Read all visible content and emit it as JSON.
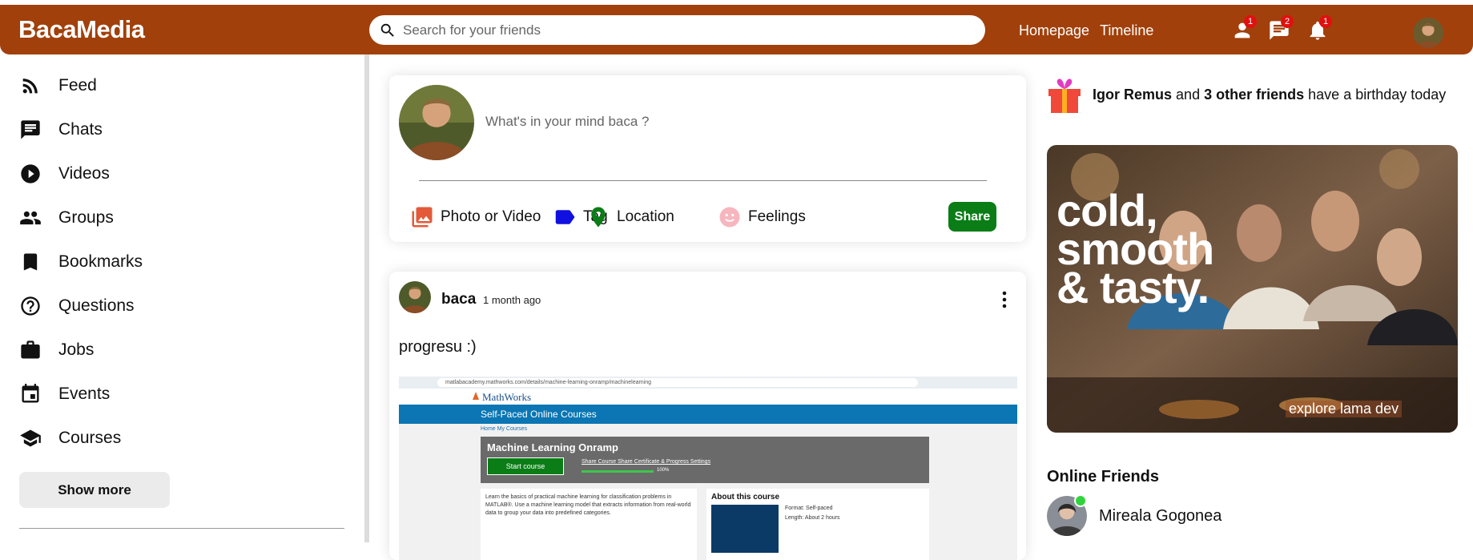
{
  "colors": {
    "brand": "#a1400b",
    "share_green": "#0a7d16",
    "badge_red": "#e01010",
    "online_green": "#32d43d"
  },
  "topbar": {
    "logo": "BacaMedia",
    "search_placeholder": "Search for your friends",
    "links": [
      "Homepage",
      "Timeline"
    ],
    "icons": [
      {
        "name": "person-icon",
        "badge": "1"
      },
      {
        "name": "chat-icon",
        "badge": "2"
      },
      {
        "name": "notifications-icon",
        "badge": "1"
      }
    ]
  },
  "sidebar": {
    "items": [
      {
        "label": "Feed",
        "icon": "rss-feed-icon"
      },
      {
        "label": "Chats",
        "icon": "chat-icon"
      },
      {
        "label": "Videos",
        "icon": "play-circle-icon"
      },
      {
        "label": "Groups",
        "icon": "group-icon"
      },
      {
        "label": "Bookmarks",
        "icon": "bookmark-icon"
      },
      {
        "label": "Questions",
        "icon": "help-circle-icon"
      },
      {
        "label": "Jobs",
        "icon": "briefcase-icon"
      },
      {
        "label": "Events",
        "icon": "calendar-icon"
      },
      {
        "label": "Courses",
        "icon": "school-icon"
      }
    ],
    "show_more": "Show more"
  },
  "share": {
    "placeholder": "What's in your mind baca ?",
    "options": [
      "Photo or Video",
      "Tag",
      "Location",
      "Feelings"
    ],
    "button": "Share"
  },
  "post": {
    "username": "baca",
    "time": "1 month ago",
    "text": "progresu :)",
    "screenshot": {
      "url": "matlabacademy.mathworks.com/details/machine-learning-onramp/machinelearning",
      "brand": "MathWorks",
      "banner": "Self-Paced Online Courses",
      "crumbs": "Home  My Courses",
      "course_title": "Machine Learning Onramp",
      "start_button": "Start course",
      "course_links": "Share Course  Share Certificate & Progress  Settings",
      "progress": "100%",
      "description": "Learn the basics of practical machine learning for classification problems in MATLAB®. Use a machine learning model that extracts information from real-world data to group your data into predefined categories.",
      "about_title": "About this course",
      "format": "Format: Self-paced",
      "length": "Length: About 2 hours"
    }
  },
  "rightbar": {
    "birthday_name": "Igor Remus",
    "birthday_mid": "and",
    "birthday_others": "3 other friends",
    "birthday_suffix": "have a birthday today",
    "ad_lines": [
      "cold,",
      "smooth",
      "& tasty."
    ],
    "ad_footer": "explore lama dev",
    "online_title": "Online Friends",
    "friends": [
      {
        "name": "Mireala Gogonea"
      }
    ]
  }
}
